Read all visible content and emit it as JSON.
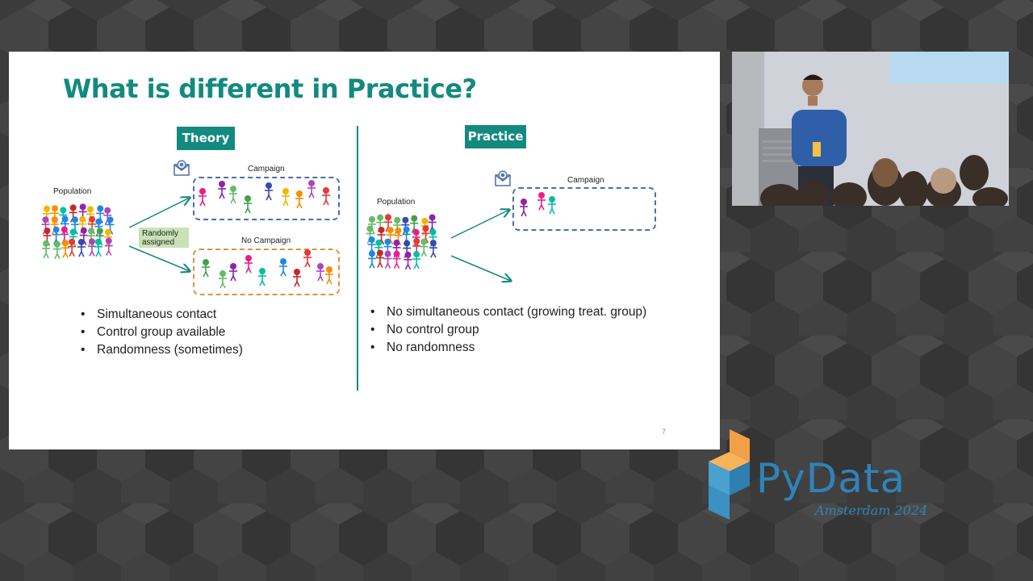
{
  "slide": {
    "title": "What is different in Practice?",
    "page_number": "7",
    "theory": {
      "tag": "Theory",
      "population_label": "Population",
      "campaign_label": "Campaign",
      "no_campaign_label": "No Campaign",
      "randomly_assigned_label": "Randomly\nassigned",
      "bullets": [
        "Simultaneous contact",
        "Control group available",
        "Randomness (sometimes)"
      ]
    },
    "practice": {
      "tag": "Practice",
      "population_label": "Population",
      "campaign_label": "Campaign",
      "bullets": [
        "No simultaneous contact (growing treat. group)",
        "No control group",
        "No randomness"
      ]
    },
    "icons": {
      "mail": "mail-icon",
      "person": "person-icon"
    },
    "colors": {
      "accent": "#138a7f",
      "campaign_border": "#4a6fa5",
      "no_campaign_border": "#e0904a",
      "random_label_bg": "#c8e2b5",
      "people": [
        "#e91e8c",
        "#f4b400",
        "#1e88e5",
        "#43a047",
        "#e53935",
        "#8e24aa",
        "#fb8c00",
        "#00bfa5",
        "#3949ab",
        "#c62828",
        "#66bb6a",
        "#ab47bc"
      ]
    }
  },
  "branding": {
    "logo_text": "PyData",
    "event_text": "Amsterdam 2024"
  }
}
